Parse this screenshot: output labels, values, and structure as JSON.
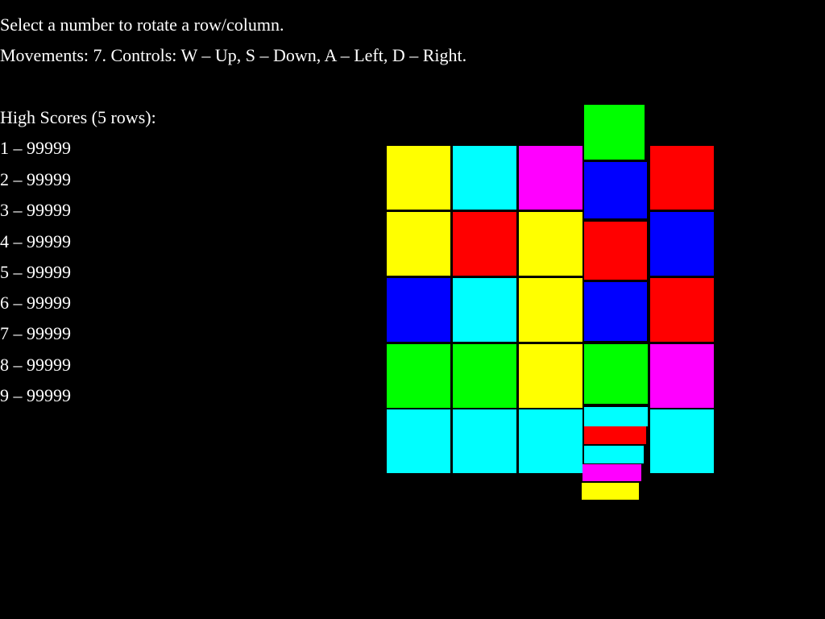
{
  "hud": {
    "instruction": "Select a number to rotate a row/column.",
    "movements": "Movements: 7. Controls: W – Up, S – Down, A – Left, D – Right."
  },
  "high_scores": {
    "title": "High Scores (5 rows):",
    "entries": [
      "1 – 99999",
      "2 – 99999",
      "3 – 99999",
      "4 – 99999",
      "5 – 99999",
      "6 – 99999",
      "7 – 99999",
      "8 – 99999",
      "9 – 99999"
    ]
  },
  "board": {
    "rows": 5,
    "cols": 5,
    "colors": {
      "yellow": "#ffff00",
      "cyan": "#00ffff",
      "magenta": "#ff00ff",
      "red": "#ff0000",
      "blue": "#0000ff",
      "green": "#00ff00"
    },
    "grid": [
      [
        "yellow",
        "cyan",
        "magenta",
        "blue",
        "red"
      ],
      [
        "yellow",
        "red",
        "yellow",
        "red",
        "blue"
      ],
      [
        "blue",
        "cyan",
        "yellow",
        "blue",
        "red"
      ],
      [
        "green",
        "green",
        "yellow",
        "green",
        "magenta"
      ],
      [
        "cyan",
        "cyan",
        "cyan",
        "cyan",
        "cyan"
      ]
    ],
    "rotating_column": 3,
    "rotating_column_extra": [
      "green",
      "red",
      "cyan",
      "magenta",
      "yellow"
    ]
  }
}
